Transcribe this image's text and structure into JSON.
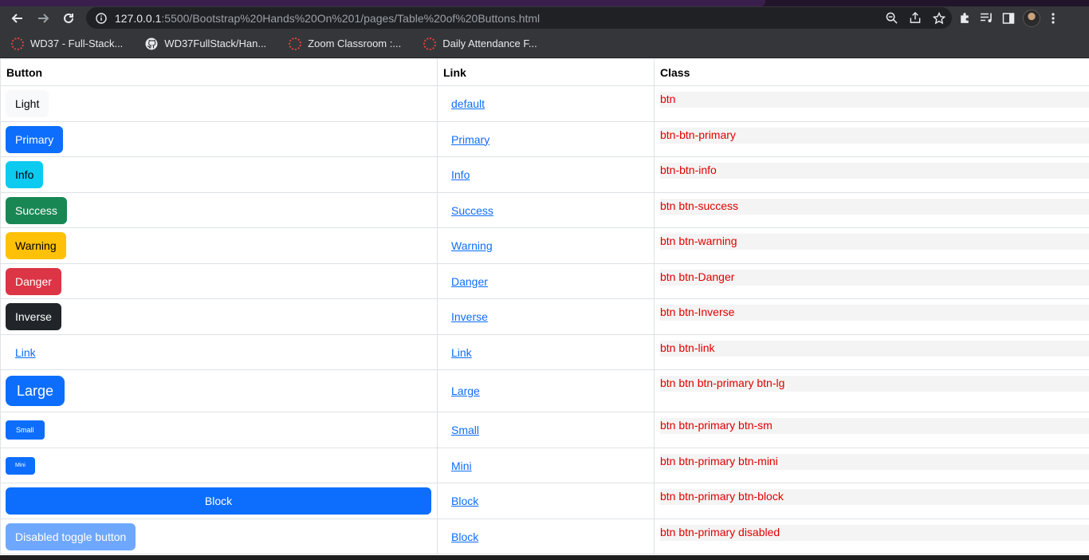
{
  "browser": {
    "url_host": "127.0.0.1",
    "url_rest": ":5500/Bootstrap%20Hands%20On%201/pages/Table%20of%20Buttons.html",
    "bookmarks": [
      {
        "label": "WD37 - Full-Stack...",
        "icon": "dotted-ring-icon"
      },
      {
        "label": "WD37FullStack/Han...",
        "icon": "github-icon"
      },
      {
        "label": "Zoom Classroom :...",
        "icon": "dotted-ring-icon"
      },
      {
        "label": "Daily Attendance F...",
        "icon": "dotted-ring-icon"
      }
    ]
  },
  "table": {
    "headers": [
      "Button",
      "Link",
      "Class"
    ],
    "rows": [
      {
        "button": "Light",
        "link": "default",
        "class": "btn"
      },
      {
        "button": "Primary",
        "link": "Primary",
        "class": "btn-btn-primary"
      },
      {
        "button": "Info",
        "link": "Info",
        "class": "btn-btn-info"
      },
      {
        "button": "Success",
        "link": "Success",
        "class": "btn btn-success"
      },
      {
        "button": "Warning",
        "link": "Warning",
        "class": "btn btn-warning"
      },
      {
        "button": "Danger",
        "link": "Danger",
        "class": "btn btn-Danger"
      },
      {
        "button": "Inverse",
        "link": "Inverse",
        "class": "btn btn-Inverse"
      },
      {
        "button": "Link",
        "link": "Link",
        "class": "btn btn-link"
      },
      {
        "button": "Large",
        "link": "Large",
        "class": "btn btn btn-primary btn-lg"
      },
      {
        "button": "Small",
        "link": "Small",
        "class": "btn btn-primary btn-sm"
      },
      {
        "button": "Mini",
        "link": "Mini",
        "class": "btn btn-primary btn-mini"
      },
      {
        "button": "Block",
        "link": "Block",
        "class": "btn btn-primary btn-block"
      },
      {
        "button": "Disabled toggle button",
        "link": "Block",
        "class": "btn btn-primary disabled"
      }
    ]
  },
  "colors": {
    "primary": "#0d6efd",
    "info": "#0dcaf0",
    "success": "#198754",
    "warning": "#ffc107",
    "danger": "#dc3545",
    "dark": "#212529",
    "code_text": "#e00000"
  }
}
